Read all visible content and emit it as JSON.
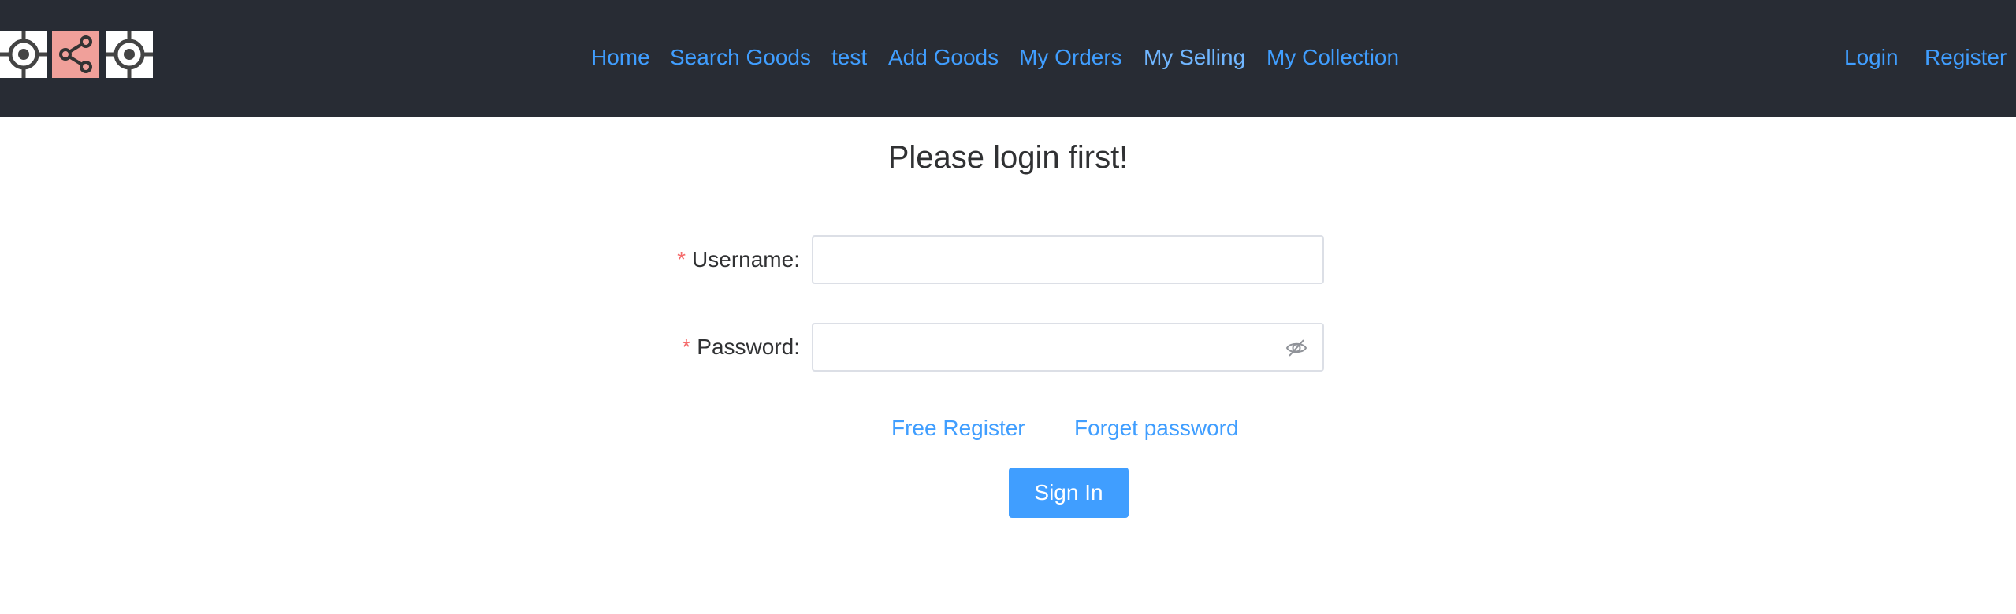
{
  "colors": {
    "header_bg": "#282c34",
    "link": "#409eff",
    "active_link": "#70b6ff",
    "required": "#f56c6c",
    "button": "#409eff",
    "logo_accent": "#f0a09a"
  },
  "header": {
    "logo_icons": [
      "target-icon",
      "share-icon",
      "target-icon"
    ],
    "nav": [
      {
        "label": "Home"
      },
      {
        "label": "Search Goods"
      },
      {
        "label": "test"
      },
      {
        "label": "Add Goods"
      },
      {
        "label": "My Orders"
      },
      {
        "label": "My Selling",
        "active": true
      },
      {
        "label": "My Collection"
      }
    ],
    "auth": {
      "login": "Login",
      "register": "Register"
    }
  },
  "form": {
    "title": "Please login first!",
    "username": {
      "required_mark": "*",
      "label": "Username",
      "colon": ":",
      "value": ""
    },
    "password": {
      "required_mark": "*",
      "label": "Password",
      "colon": ":",
      "value": "",
      "icon": "eye-slash-icon"
    },
    "free_register": "Free Register",
    "forget_password": "Forget password",
    "submit": "Sign In"
  }
}
